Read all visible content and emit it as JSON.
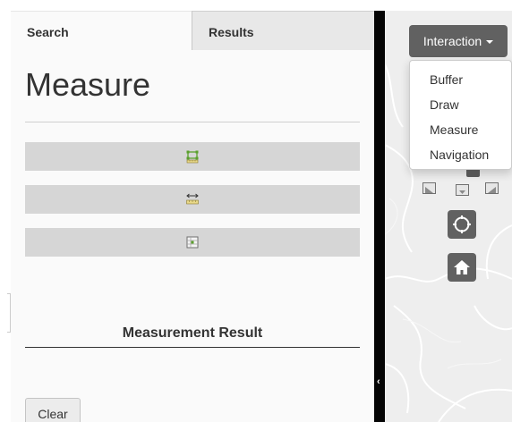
{
  "tabs": {
    "search": "Search",
    "results": "Results"
  },
  "panel": {
    "title": "Measure",
    "tools": [
      {
        "icon": "area-measure-icon"
      },
      {
        "icon": "distance-measure-icon"
      },
      {
        "icon": "location-measure-icon"
      }
    ],
    "result_title": "Measurement Result",
    "clear_label": "Clear"
  },
  "map": {
    "interaction_label": "Interaction",
    "menu": [
      "Buffer",
      "Draw",
      "Measure",
      "Navigation"
    ],
    "controls": [
      "crosshair-icon",
      "home-icon"
    ]
  },
  "colors": {
    "tool_button": "#d6d6d6",
    "map_control": "#616161",
    "splitter": "#050505",
    "map_background": "#eeeeee"
  }
}
